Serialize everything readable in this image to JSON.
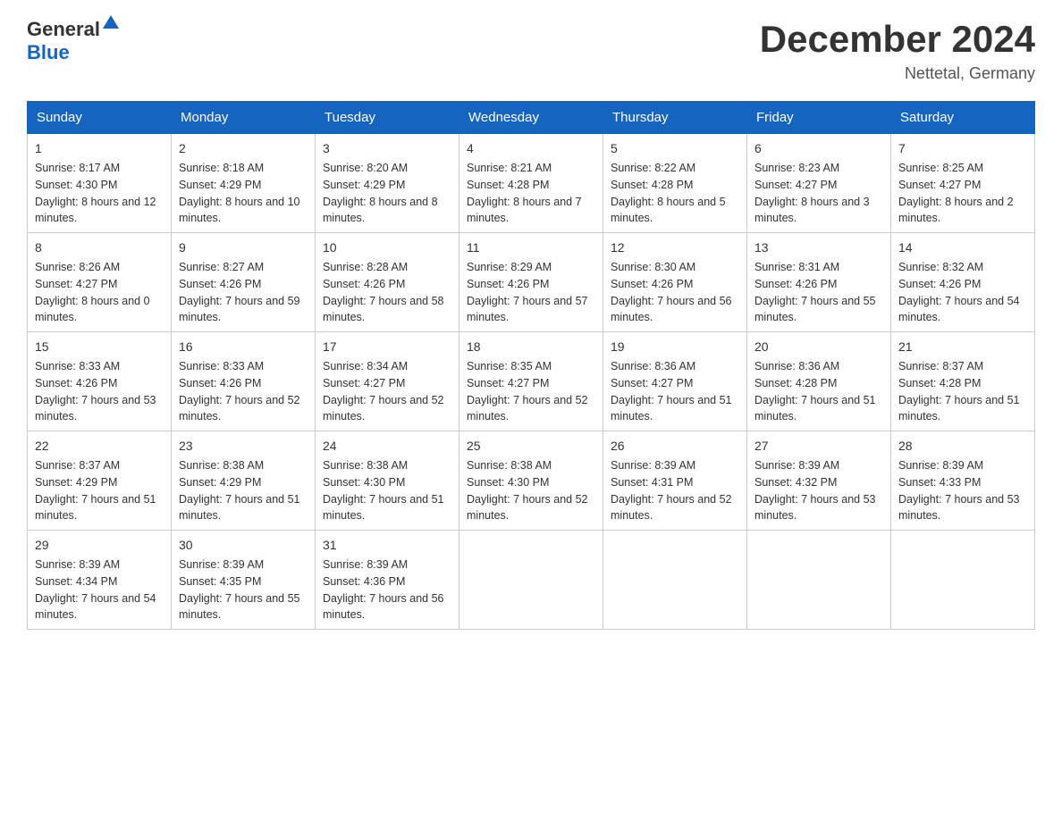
{
  "header": {
    "logo_general": "General",
    "logo_blue": "Blue",
    "month_title": "December 2024",
    "location": "Nettetal, Germany"
  },
  "days_of_week": [
    "Sunday",
    "Monday",
    "Tuesday",
    "Wednesday",
    "Thursday",
    "Friday",
    "Saturday"
  ],
  "weeks": [
    [
      {
        "day": "1",
        "sunrise": "8:17 AM",
        "sunset": "4:30 PM",
        "daylight": "8 hours and 12 minutes."
      },
      {
        "day": "2",
        "sunrise": "8:18 AM",
        "sunset": "4:29 PM",
        "daylight": "8 hours and 10 minutes."
      },
      {
        "day": "3",
        "sunrise": "8:20 AM",
        "sunset": "4:29 PM",
        "daylight": "8 hours and 8 minutes."
      },
      {
        "day": "4",
        "sunrise": "8:21 AM",
        "sunset": "4:28 PM",
        "daylight": "8 hours and 7 minutes."
      },
      {
        "day": "5",
        "sunrise": "8:22 AM",
        "sunset": "4:28 PM",
        "daylight": "8 hours and 5 minutes."
      },
      {
        "day": "6",
        "sunrise": "8:23 AM",
        "sunset": "4:27 PM",
        "daylight": "8 hours and 3 minutes."
      },
      {
        "day": "7",
        "sunrise": "8:25 AM",
        "sunset": "4:27 PM",
        "daylight": "8 hours and 2 minutes."
      }
    ],
    [
      {
        "day": "8",
        "sunrise": "8:26 AM",
        "sunset": "4:27 PM",
        "daylight": "8 hours and 0 minutes."
      },
      {
        "day": "9",
        "sunrise": "8:27 AM",
        "sunset": "4:26 PM",
        "daylight": "7 hours and 59 minutes."
      },
      {
        "day": "10",
        "sunrise": "8:28 AM",
        "sunset": "4:26 PM",
        "daylight": "7 hours and 58 minutes."
      },
      {
        "day": "11",
        "sunrise": "8:29 AM",
        "sunset": "4:26 PM",
        "daylight": "7 hours and 57 minutes."
      },
      {
        "day": "12",
        "sunrise": "8:30 AM",
        "sunset": "4:26 PM",
        "daylight": "7 hours and 56 minutes."
      },
      {
        "day": "13",
        "sunrise": "8:31 AM",
        "sunset": "4:26 PM",
        "daylight": "7 hours and 55 minutes."
      },
      {
        "day": "14",
        "sunrise": "8:32 AM",
        "sunset": "4:26 PM",
        "daylight": "7 hours and 54 minutes."
      }
    ],
    [
      {
        "day": "15",
        "sunrise": "8:33 AM",
        "sunset": "4:26 PM",
        "daylight": "7 hours and 53 minutes."
      },
      {
        "day": "16",
        "sunrise": "8:33 AM",
        "sunset": "4:26 PM",
        "daylight": "7 hours and 52 minutes."
      },
      {
        "day": "17",
        "sunrise": "8:34 AM",
        "sunset": "4:27 PM",
        "daylight": "7 hours and 52 minutes."
      },
      {
        "day": "18",
        "sunrise": "8:35 AM",
        "sunset": "4:27 PM",
        "daylight": "7 hours and 52 minutes."
      },
      {
        "day": "19",
        "sunrise": "8:36 AM",
        "sunset": "4:27 PM",
        "daylight": "7 hours and 51 minutes."
      },
      {
        "day": "20",
        "sunrise": "8:36 AM",
        "sunset": "4:28 PM",
        "daylight": "7 hours and 51 minutes."
      },
      {
        "day": "21",
        "sunrise": "8:37 AM",
        "sunset": "4:28 PM",
        "daylight": "7 hours and 51 minutes."
      }
    ],
    [
      {
        "day": "22",
        "sunrise": "8:37 AM",
        "sunset": "4:29 PM",
        "daylight": "7 hours and 51 minutes."
      },
      {
        "day": "23",
        "sunrise": "8:38 AM",
        "sunset": "4:29 PM",
        "daylight": "7 hours and 51 minutes."
      },
      {
        "day": "24",
        "sunrise": "8:38 AM",
        "sunset": "4:30 PM",
        "daylight": "7 hours and 51 minutes."
      },
      {
        "day": "25",
        "sunrise": "8:38 AM",
        "sunset": "4:30 PM",
        "daylight": "7 hours and 52 minutes."
      },
      {
        "day": "26",
        "sunrise": "8:39 AM",
        "sunset": "4:31 PM",
        "daylight": "7 hours and 52 minutes."
      },
      {
        "day": "27",
        "sunrise": "8:39 AM",
        "sunset": "4:32 PM",
        "daylight": "7 hours and 53 minutes."
      },
      {
        "day": "28",
        "sunrise": "8:39 AM",
        "sunset": "4:33 PM",
        "daylight": "7 hours and 53 minutes."
      }
    ],
    [
      {
        "day": "29",
        "sunrise": "8:39 AM",
        "sunset": "4:34 PM",
        "daylight": "7 hours and 54 minutes."
      },
      {
        "day": "30",
        "sunrise": "8:39 AM",
        "sunset": "4:35 PM",
        "daylight": "7 hours and 55 minutes."
      },
      {
        "day": "31",
        "sunrise": "8:39 AM",
        "sunset": "4:36 PM",
        "daylight": "7 hours and 56 minutes."
      },
      null,
      null,
      null,
      null
    ]
  ],
  "labels": {
    "sunrise": "Sunrise:",
    "sunset": "Sunset:",
    "daylight": "Daylight:"
  }
}
